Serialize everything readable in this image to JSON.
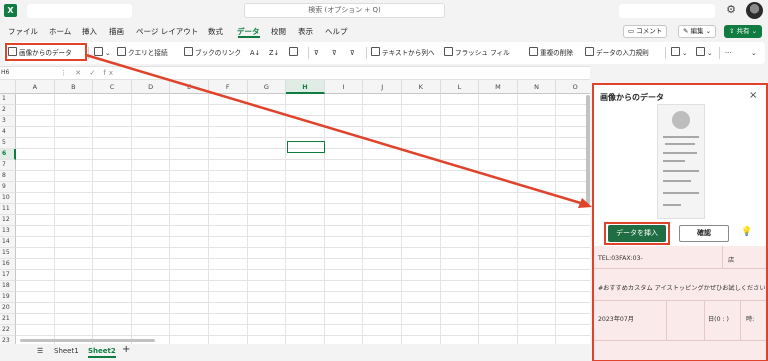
{
  "titlebar": {
    "app_icon": "X",
    "search_placeholder": "検索 (オプション + Q)",
    "icons": {
      "settings": "gear-icon",
      "account": "avatar"
    }
  },
  "ribbon_tabs": [
    "ファイル",
    "ホーム",
    "挿入",
    "描画",
    "ページ レイアウト",
    "数式",
    "データ",
    "校閲",
    "表示",
    "ヘルプ"
  ],
  "active_tab": "データ",
  "top_buttons": {
    "comments": "コメント",
    "editing": "編集",
    "share": "共有"
  },
  "ribbon": {
    "image_data": "画像からのデータ",
    "queries": "クエリと接続",
    "workbook_links": "ブックのリンク",
    "text_to_columns": "テキストから列へ",
    "flash_fill": "フラッシュ フィル",
    "remove_duplicates": "重複の削除",
    "data_validation": "データの入力規則",
    "more": "···"
  },
  "formula_bar": {
    "name_box": "H6",
    "icons": "⋮ ✕ ✓ fx"
  },
  "grid": {
    "columns": [
      "A",
      "B",
      "C",
      "D",
      "E",
      "F",
      "G",
      "H",
      "I",
      "J",
      "K",
      "L",
      "M",
      "N",
      "O"
    ],
    "rows": [
      "1",
      "2",
      "3",
      "4",
      "5",
      "6",
      "7",
      "8",
      "9",
      "10",
      "11",
      "12",
      "13",
      "14",
      "15",
      "16",
      "17",
      "18",
      "19",
      "20",
      "21",
      "22",
      "23"
    ],
    "selected_column": "H",
    "selected_row": "6"
  },
  "sheets": [
    "Sheet1",
    "Sheet2"
  ],
  "active_sheet": "Sheet2",
  "add_sheet": "+",
  "pane": {
    "title": "画像からのデータ",
    "close": "×",
    "insert_button": "データを挿入",
    "confirm_button": "確認",
    "results": {
      "row1_a": "TEL:03FAX:03-",
      "row1_b": "店",
      "row2": "#おすすめカスタム アイストッピングかぜひお試しください",
      "row3_a": "2023年07月",
      "row3_b": "日(0 : )",
      "row3_c": "時:"
    }
  },
  "colors": {
    "accent": "#107c41",
    "highlight": "#e0432b",
    "result_bg": "#fbeaea"
  }
}
